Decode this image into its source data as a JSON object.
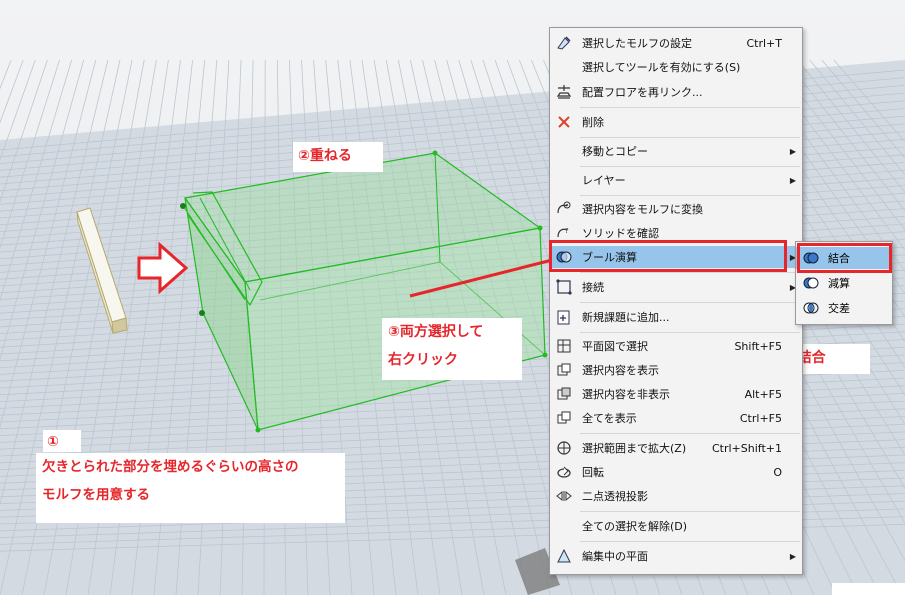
{
  "callouts": {
    "step1_number": "①",
    "step1_text_line1": "欠きとられた部分を埋めるぐらいの高さの",
    "step1_text_line2": "モルフを用意する",
    "step2": "②重ねる",
    "step3_line1": "③両方選択して",
    "step3_line2": "右クリック",
    "step4": "④ブール演算→結合"
  },
  "context_menu": {
    "items": [
      {
        "label": "選択したモルフの設定",
        "shortcut": "Ctrl+T",
        "icon": "morph-settings-icon"
      },
      {
        "label": "選択してツールを有効にする(S)",
        "shortcut": "",
        "icon": ""
      },
      {
        "label": "配置フロアを再リンク...",
        "shortcut": "",
        "icon": "relink-floor-icon"
      },
      {
        "label": "削除",
        "shortcut": "",
        "icon": "delete-x-icon"
      },
      {
        "label": "移動とコピー",
        "shortcut": "",
        "icon": "",
        "submenu": true
      },
      {
        "label": "レイヤー",
        "shortcut": "",
        "icon": "",
        "submenu": true
      },
      {
        "label": "選択内容をモルフに変換",
        "shortcut": "",
        "icon": "convert-to-morph-icon"
      },
      {
        "label": "ソリッドを確認",
        "shortcut": "",
        "icon": "check-solid-icon"
      },
      {
        "label": "ブール演算",
        "shortcut": "",
        "icon": "boolean-icon",
        "submenu": true
      },
      {
        "label": "接続",
        "shortcut": "",
        "icon": "connect-icon",
        "submenu": true
      },
      {
        "label": "新規課題に追加...",
        "shortcut": "",
        "icon": "add-issue-icon"
      },
      {
        "label": "平面図で選択",
        "shortcut": "Shift+F5",
        "icon": "select-in-plan-icon"
      },
      {
        "label": "選択内容を表示",
        "shortcut": "",
        "icon": "show-selection-icon"
      },
      {
        "label": "選択内容を非表示",
        "shortcut": "Alt+F5",
        "icon": "hide-selection-icon"
      },
      {
        "label": "全てを表示",
        "shortcut": "Ctrl+F5",
        "icon": "show-all-icon"
      },
      {
        "label": "選択範囲まで拡大(Z)",
        "shortcut": "Ctrl+Shift+1",
        "icon": "zoom-to-selection-icon"
      },
      {
        "label": "回転",
        "shortcut": "O",
        "icon": "orbit-icon"
      },
      {
        "label": "二点透視投影",
        "shortcut": "",
        "icon": "two-point-perspective-icon"
      },
      {
        "label": "全ての選択を解除(D)",
        "shortcut": "",
        "icon": ""
      },
      {
        "label": "編集中の平面",
        "shortcut": "",
        "icon": "editing-plane-icon",
        "submenu": true
      }
    ]
  },
  "boolean_submenu": {
    "items": [
      {
        "label": "結合",
        "icon": "union-icon"
      },
      {
        "label": "減算",
        "icon": "subtract-icon"
      },
      {
        "label": "交差",
        "icon": "intersect-icon"
      }
    ]
  },
  "colors": {
    "accent_red": "#e6262b",
    "selection_green": "#22bb22",
    "menu_highlight": "#96c4ea"
  }
}
